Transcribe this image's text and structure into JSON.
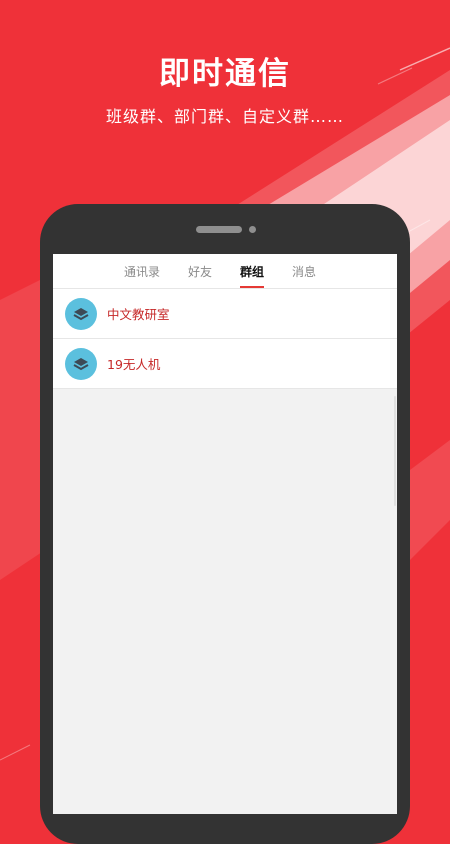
{
  "hero": {
    "title": "即时通信",
    "subtitle": "班级群、部门群、自定义群……"
  },
  "tabs": [
    {
      "label": "通讯录",
      "active": false
    },
    {
      "label": "好友",
      "active": false
    },
    {
      "label": "群组",
      "active": true
    },
    {
      "label": "消息",
      "active": false
    }
  ],
  "groups": [
    {
      "name": "中文教研室",
      "icon": "layers-icon"
    },
    {
      "name": "19无人机",
      "icon": "layers-icon"
    }
  ],
  "colors": {
    "brand_red": "#ef3139",
    "avatar_blue": "#5bc0de",
    "active_tab_underline": "#e53935",
    "group_name_red": "#c62828"
  }
}
